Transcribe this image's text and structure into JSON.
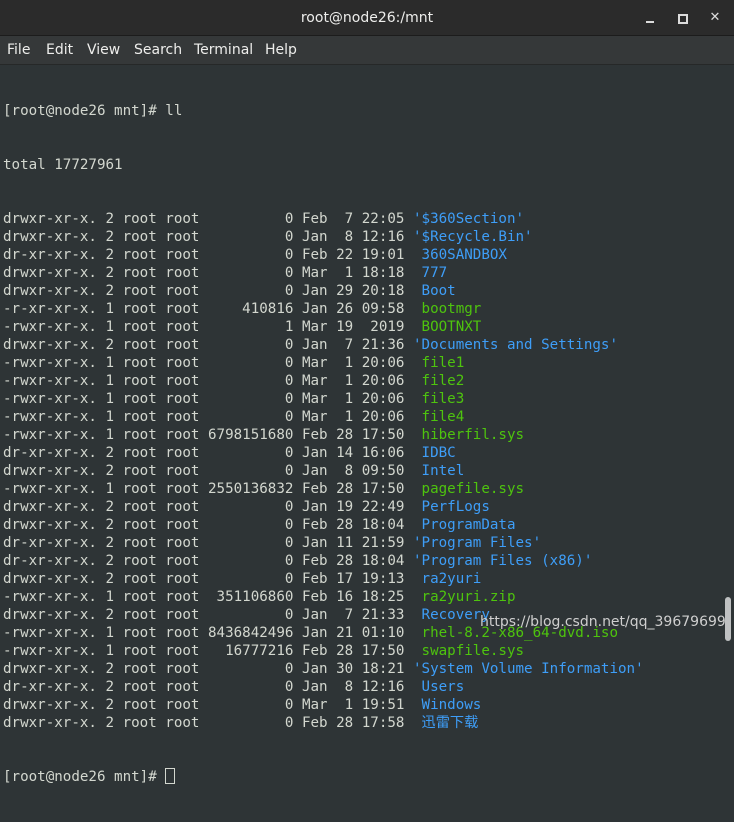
{
  "window": {
    "title": "root@node26:/mnt",
    "minimize_glyph": "",
    "maximize_glyph": "",
    "close_glyph": "✕"
  },
  "menubar": {
    "items": [
      "File",
      "Edit",
      "View",
      "Search",
      "Terminal",
      "Help"
    ]
  },
  "colors": {
    "terminal_bg": "#2e3436",
    "text": "#d3d7cf",
    "directory": "#3e9ef8",
    "executable": "#4ec40e"
  },
  "terminal": {
    "prompt_line": "[root@node26 mnt]# ll",
    "total_line": "total 17727961",
    "entries": [
      {
        "meta": "drwxr-xr-x. 2 root root          0 Feb  7 22:05 ",
        "name": "'$360Section'",
        "kind": "dir"
      },
      {
        "meta": "drwxr-xr-x. 2 root root          0 Jan  8 12:16 ",
        "name": "'$Recycle.Bin'",
        "kind": "dir"
      },
      {
        "meta": "dr-xr-xr-x. 2 root root          0 Feb 22 19:01 ",
        "name": " 360SANDBOX",
        "kind": "dir"
      },
      {
        "meta": "drwxr-xr-x. 2 root root          0 Mar  1 18:18 ",
        "name": " 777",
        "kind": "dir"
      },
      {
        "meta": "drwxr-xr-x. 2 root root          0 Jan 29 20:18 ",
        "name": " Boot",
        "kind": "dir"
      },
      {
        "meta": "-r-xr-xr-x. 1 root root     410816 Jan 26 09:58 ",
        "name": " bootmgr",
        "kind": "exe"
      },
      {
        "meta": "-rwxr-xr-x. 1 root root          1 Mar 19  2019 ",
        "name": " BOOTNXT",
        "kind": "exe"
      },
      {
        "meta": "drwxr-xr-x. 2 root root          0 Jan  7 21:36 ",
        "name": "'Documents and Settings'",
        "kind": "dir"
      },
      {
        "meta": "-rwxr-xr-x. 1 root root          0 Mar  1 20:06 ",
        "name": " file1",
        "kind": "exe"
      },
      {
        "meta": "-rwxr-xr-x. 1 root root          0 Mar  1 20:06 ",
        "name": " file2",
        "kind": "exe"
      },
      {
        "meta": "-rwxr-xr-x. 1 root root          0 Mar  1 20:06 ",
        "name": " file3",
        "kind": "exe"
      },
      {
        "meta": "-rwxr-xr-x. 1 root root          0 Mar  1 20:06 ",
        "name": " file4",
        "kind": "exe"
      },
      {
        "meta": "-rwxr-xr-x. 1 root root 6798151680 Feb 28 17:50 ",
        "name": " hiberfil.sys",
        "kind": "exe"
      },
      {
        "meta": "dr-xr-xr-x. 2 root root          0 Jan 14 16:06 ",
        "name": " IDBC",
        "kind": "dir"
      },
      {
        "meta": "drwxr-xr-x. 2 root root          0 Jan  8 09:50 ",
        "name": " Intel",
        "kind": "dir"
      },
      {
        "meta": "-rwxr-xr-x. 1 root root 2550136832 Feb 28 17:50 ",
        "name": " pagefile.sys",
        "kind": "exe"
      },
      {
        "meta": "drwxr-xr-x. 2 root root          0 Jan 19 22:49 ",
        "name": " PerfLogs",
        "kind": "dir"
      },
      {
        "meta": "drwxr-xr-x. 2 root root          0 Feb 28 18:04 ",
        "name": " ProgramData",
        "kind": "dir"
      },
      {
        "meta": "dr-xr-xr-x. 2 root root          0 Jan 11 21:59 ",
        "name": "'Program Files'",
        "kind": "dir"
      },
      {
        "meta": "dr-xr-xr-x. 2 root root          0 Feb 28 18:04 ",
        "name": "'Program Files (x86)'",
        "kind": "dir"
      },
      {
        "meta": "drwxr-xr-x. 2 root root          0 Feb 17 19:13 ",
        "name": " ra2yuri",
        "kind": "dir"
      },
      {
        "meta": "-rwxr-xr-x. 1 root root  351106860 Feb 16 18:25 ",
        "name": " ra2yuri.zip",
        "kind": "exe"
      },
      {
        "meta": "drwxr-xr-x. 2 root root          0 Jan  7 21:33 ",
        "name": " Recovery",
        "kind": "dir"
      },
      {
        "meta": "-rwxr-xr-x. 1 root root 8436842496 Jan 21 01:10 ",
        "name": " rhel-8.2-x86_64-dvd.iso",
        "kind": "exe"
      },
      {
        "meta": "-rwxr-xr-x. 1 root root   16777216 Feb 28 17:50 ",
        "name": " swapfile.sys",
        "kind": "exe"
      },
      {
        "meta": "drwxr-xr-x. 2 root root          0 Jan 30 18:21 ",
        "name": "'System Volume Information'",
        "kind": "dir"
      },
      {
        "meta": "dr-xr-xr-x. 2 root root          0 Jan  8 12:16 ",
        "name": " Users",
        "kind": "dir"
      },
      {
        "meta": "drwxr-xr-x. 2 root root          0 Mar  1 19:51 ",
        "name": " Windows",
        "kind": "dir"
      },
      {
        "meta": "drwxr-xr-x. 2 root root          0 Feb 28 17:58 ",
        "name": " 迅雷下载",
        "kind": "dir"
      }
    ],
    "final_prompt": "[root@node26 mnt]# "
  },
  "watermark": "https://blog.csdn.net/qq_39679699"
}
